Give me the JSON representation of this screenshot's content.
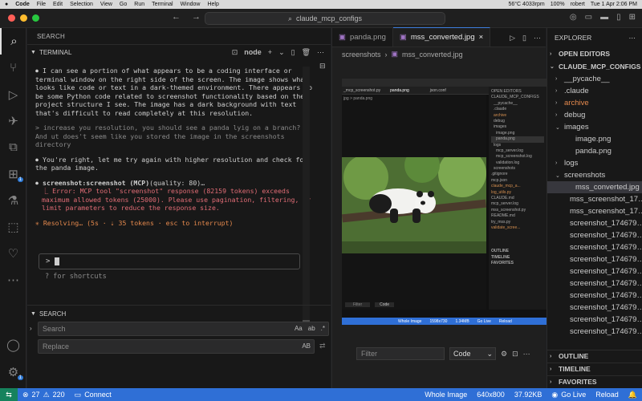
{
  "mac_menu": {
    "apple": "",
    "app": "Code",
    "items": [
      "File",
      "Edit",
      "Selection",
      "View",
      "Go",
      "Run",
      "Terminal",
      "Window",
      "Help"
    ],
    "cpu": "56°C 4033rpm",
    "battery": "100%",
    "user": "robert",
    "time": "Tue 1 Apr  2:06 PM"
  },
  "window": {
    "search": "claude_mcp_configs"
  },
  "sidebar": {
    "header": "SEARCH",
    "terminal_title": "TERMINAL",
    "shell": "node"
  },
  "terminal": {
    "msg1": "I can see a portion of what appears to be a coding interface or terminal window on the right side of the screen. The image shows what looks like code or text in a dark-themed environment. There appears to be some Python code related to screenshot functionality based on the project structure I see. The image has a dark background with text that's difficult to read completely at this resolution.",
    "user1": "increase you resolution, you should see a panda lyig on a branch? And ut does't seem like you stored the image in the screenshots directory",
    "msg2": "You're right, let me try again with higher resolution and check for the panda image.",
    "tool_call": "screenshot:screenshot (MCP)",
    "tool_args": "(quality: 80)…",
    "error": "Error: MCP tool \"screenshot\" response (82159 tokens) exceeds maximum allowed tokens (25000). Please use pagination, filtering, or limit parameters to reduce the response size.",
    "status": "Resolving… (5s · ⇣ 35 tokens · esc to interrupt)",
    "prompt": ">",
    "hint": "? for shortcuts"
  },
  "search": {
    "header": "SEARCH",
    "search_placeholder": "Search",
    "replace_placeholder": "Replace",
    "opt_case": "Aa",
    "opt_word": "ab",
    "opt_regex": ".*",
    "opt_preserve": "AB"
  },
  "editor": {
    "tabs": [
      {
        "label": "panda.png",
        "active": false
      },
      {
        "label": "mss_converted.jpg",
        "active": true
      }
    ],
    "breadcrumb": [
      "screenshots",
      "mss_converted.jpg"
    ],
    "filter_placeholder": "Filter",
    "code_select": "Code"
  },
  "screenshot_inner": {
    "tabs": [
      "_mcp_screenshot.py",
      "panda.png",
      "json.conf"
    ],
    "crumb": "jpg > panda.png",
    "explorer": [
      "OPEN EDITORS",
      "CLAUDE_MCP_CONFIGS",
      "__pycache__",
      ".claude",
      "archive",
      "debug",
      "images",
      "image.png",
      "panda.png",
      "logs",
      "mcp_server.log",
      "mcp_screenshot.log",
      "validation.log",
      "screenshots",
      ".gitignore",
      "mcp.json",
      "claude_mcp_a...",
      "log_utils.py",
      "CLAUDE.md",
      "mcp_server.log",
      "mss_screenshot.py",
      "README.md",
      "try_mss.py",
      "validate_scree..."
    ],
    "outline": [
      "OUTLINE",
      "TIMELINE",
      "FAVORITES"
    ],
    "status": [
      "Whole Image",
      "1598x730",
      "1.34MB",
      "Go Live",
      "Reload"
    ],
    "filter": "Filter",
    "code": "Code"
  },
  "explorer": {
    "title": "EXPLORER",
    "open_editors": "OPEN EDITORS",
    "project": "CLAUDE_MCP_CONFIGS",
    "items": [
      {
        "label": "__pycache__",
        "kind": "folder",
        "level": 1,
        "color": "normal"
      },
      {
        "label": ".claude",
        "kind": "folder",
        "level": 1,
        "color": "normal"
      },
      {
        "label": "archive",
        "kind": "folder",
        "level": 1,
        "color": "orange"
      },
      {
        "label": "debug",
        "kind": "folder",
        "level": 1,
        "color": "normal"
      },
      {
        "label": "images",
        "kind": "folder-open",
        "level": 1,
        "color": "normal"
      },
      {
        "label": "image.png",
        "kind": "file",
        "level": 2,
        "color": "normal"
      },
      {
        "label": "panda.png",
        "kind": "file",
        "level": 2,
        "color": "normal"
      },
      {
        "label": "logs",
        "kind": "folder",
        "level": 1,
        "color": "normal"
      },
      {
        "label": "screenshots",
        "kind": "folder-open",
        "level": 1,
        "color": "normal"
      },
      {
        "label": "mss_converted.jpg",
        "kind": "file",
        "level": 2,
        "color": "selected"
      },
      {
        "label": "mss_screenshot_17…",
        "kind": "file",
        "level": 2,
        "color": "normal"
      },
      {
        "label": "mss_screenshot_17…",
        "kind": "file",
        "level": 2,
        "color": "normal"
      },
      {
        "label": "screenshot_174679…",
        "kind": "file",
        "level": 2,
        "color": "normal"
      },
      {
        "label": "screenshot_174679…",
        "kind": "file",
        "level": 2,
        "color": "normal"
      },
      {
        "label": "screenshot_174679…",
        "kind": "file",
        "level": 2,
        "color": "normal"
      },
      {
        "label": "screenshot_174679…",
        "kind": "file",
        "level": 2,
        "color": "normal"
      },
      {
        "label": "screenshot_174679…",
        "kind": "file",
        "level": 2,
        "color": "normal"
      },
      {
        "label": "screenshot_174679…",
        "kind": "file",
        "level": 2,
        "color": "normal"
      },
      {
        "label": "screenshot_174679…",
        "kind": "file",
        "level": 2,
        "color": "normal"
      },
      {
        "label": "screenshot_174679…",
        "kind": "file",
        "level": 2,
        "color": "normal"
      },
      {
        "label": "screenshot_174679…",
        "kind": "file",
        "level": 2,
        "color": "normal"
      },
      {
        "label": "screenshot_174679…",
        "kind": "file",
        "level": 2,
        "color": "normal"
      }
    ],
    "outline": "OUTLINE",
    "timeline": "TIMELINE",
    "favorites": "FAVORITES"
  },
  "statusbar": {
    "errors": "27",
    "warnings": "220",
    "connect": "Connect",
    "image_mode": "Whole Image",
    "dimensions": "640x800",
    "size": "37.92KB",
    "golive": "Go Live",
    "reload": "Reload"
  }
}
